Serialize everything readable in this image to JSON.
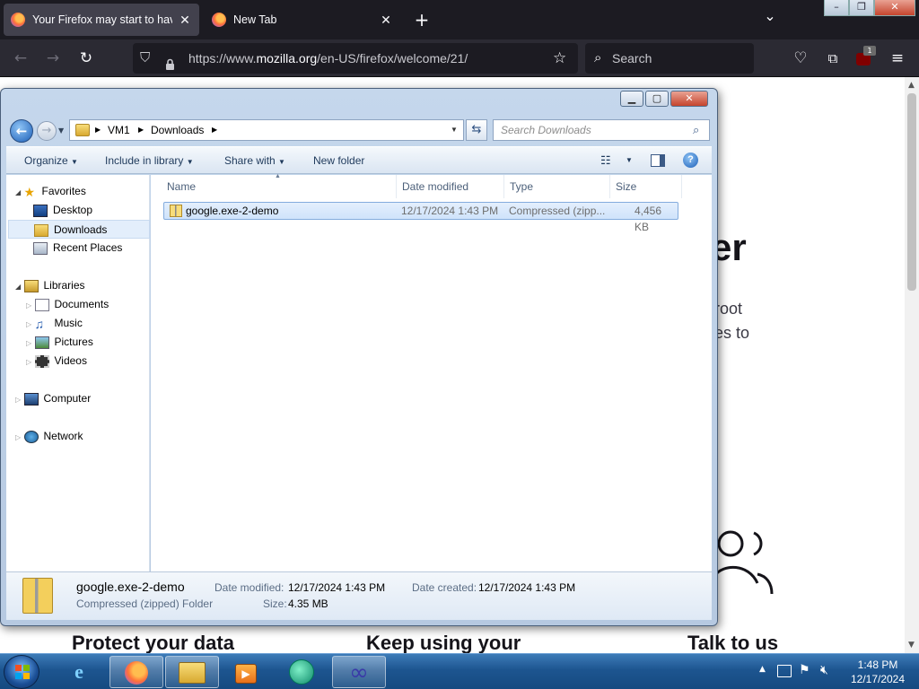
{
  "browser": {
    "tabs": [
      {
        "title": "Your Firefox may start to have p",
        "close": "✕"
      },
      {
        "title": "New Tab",
        "close": "✕"
      }
    ],
    "new_tab": "+",
    "tab_list": "⌄",
    "window_controls": {
      "minimize": "–",
      "restore": "❐",
      "close": "✕"
    },
    "url_prefix": "https://www.",
    "url_domain": "mozilla.org",
    "url_path": "/en-US/firefox/welcome/21/",
    "search_placeholder": "Search",
    "extension_badge": "1"
  },
  "webpage": {
    "headline_fragment": "er",
    "body_line1": "root",
    "body_line2": "es to",
    "card1": "Protect your data",
    "card2": "Keep using your",
    "card3": "Talk to us"
  },
  "explorer": {
    "breadcrumb": [
      "VM1",
      "Downloads"
    ],
    "search_placeholder": "Search Downloads",
    "toolbar": {
      "organize": "Organize",
      "include": "Include in library",
      "share": "Share with",
      "new_folder": "New folder"
    },
    "nav": {
      "favorites": "Favorites",
      "desktop": "Desktop",
      "downloads": "Downloads",
      "recent": "Recent Places",
      "libraries": "Libraries",
      "documents": "Documents",
      "music": "Music",
      "pictures": "Pictures",
      "videos": "Videos",
      "computer": "Computer",
      "network": "Network"
    },
    "columns": {
      "name": "Name",
      "date": "Date modified",
      "type": "Type",
      "size": "Size"
    },
    "file": {
      "name": "google.exe-2-demo",
      "date": "12/17/2024 1:43 PM",
      "type": "Compressed (zipp...",
      "size": "4,456 KB"
    },
    "details": {
      "name": "google.exe-2-demo",
      "kind": "Compressed (zipped) Folder",
      "modified_label": "Date modified:",
      "modified": "12/17/2024 1:43 PM",
      "size_label": "Size:",
      "size": "4.35 MB",
      "created_label": "Date created:",
      "created": "12/17/2024 1:43 PM"
    }
  },
  "taskbar": {
    "time": "1:48 PM",
    "date": "12/17/2024"
  }
}
